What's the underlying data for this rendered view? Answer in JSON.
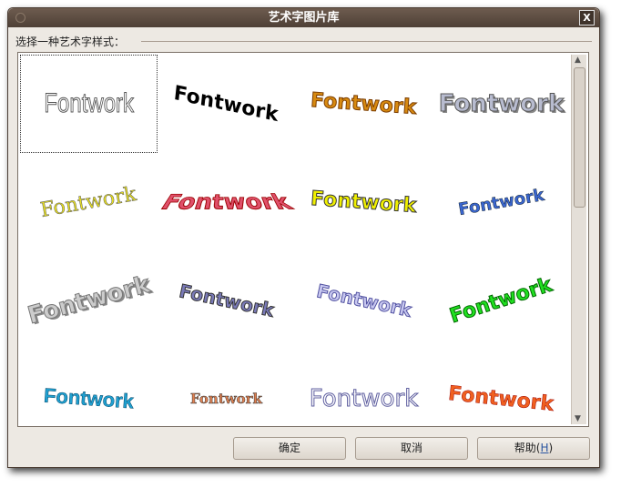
{
  "window": {
    "title": "艺术字图片库",
    "close_label": "X"
  },
  "prompt": "选择一种艺术字样式：",
  "gallery": {
    "items": [
      "Fontwork",
      "Fontwork",
      "Fontwork",
      "Fontwork",
      "Fontwork",
      "Fontwork",
      "Fontwork",
      "Fontwork",
      "Fontwork",
      "Fontwork",
      "Fontwork",
      "Fontwork",
      "Fontwork",
      "Fontwork",
      "Fontwork",
      "Fontwork"
    ],
    "selected_index": 0
  },
  "buttons": {
    "ok": "确定",
    "cancel": "取消",
    "help": "帮助(",
    "help_key": "H",
    "help_close": ")"
  }
}
